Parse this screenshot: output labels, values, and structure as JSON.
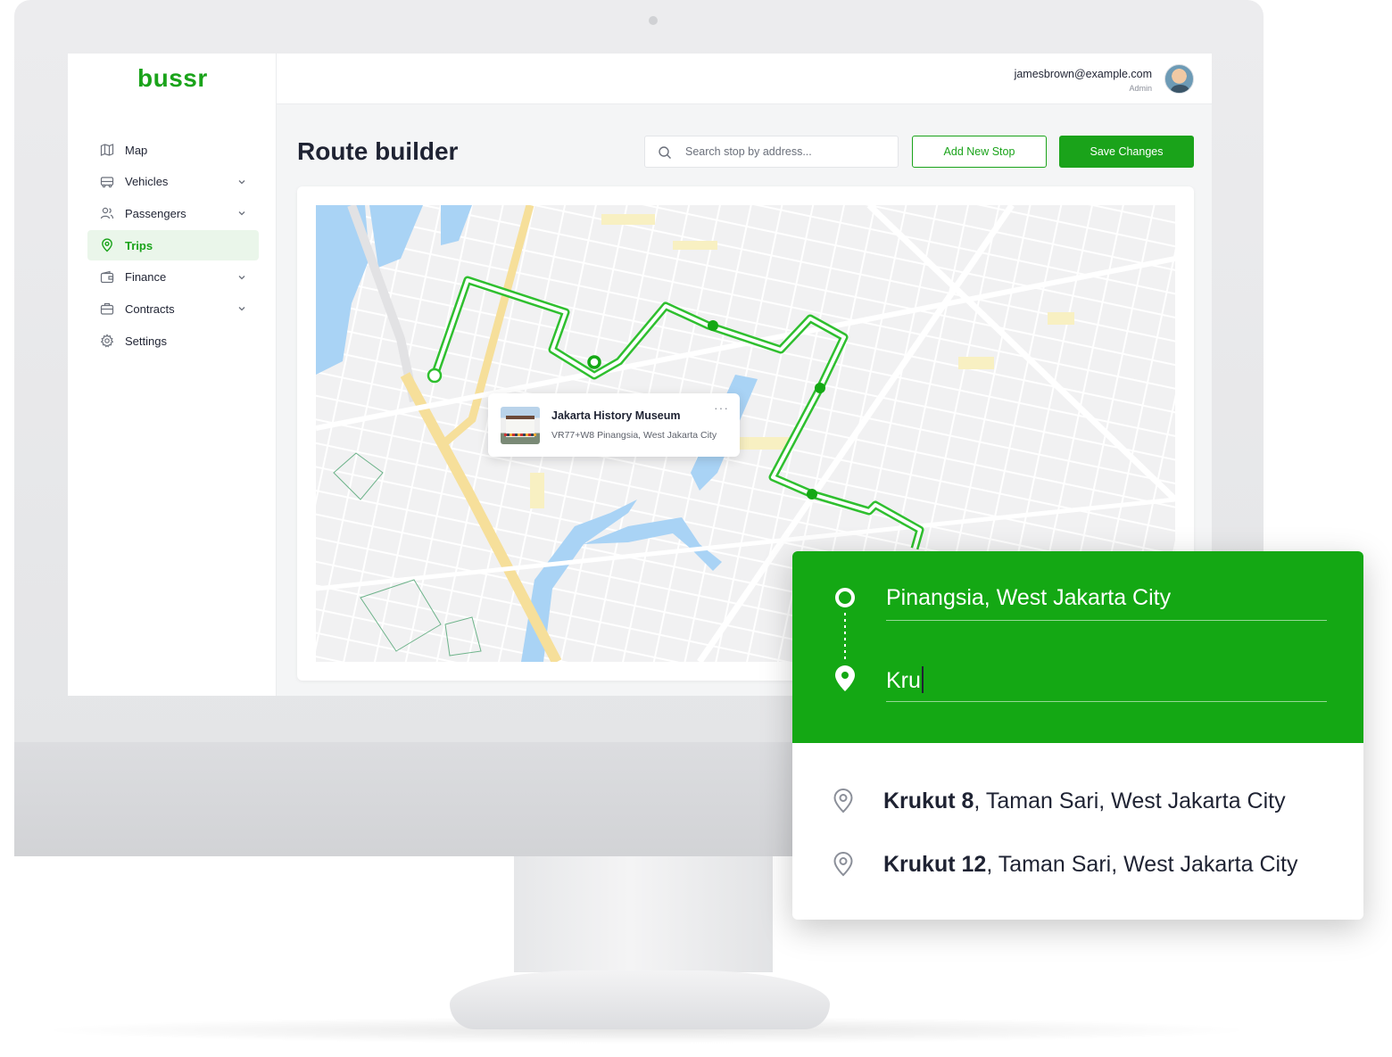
{
  "brand": {
    "logo_text": "bussr",
    "accent_color": "#1aa31a"
  },
  "sidebar": {
    "items": [
      {
        "label": "Map",
        "icon": "map-icon",
        "has_chevron": false,
        "active": false
      },
      {
        "label": "Vehicles",
        "icon": "bus-icon",
        "has_chevron": true,
        "active": false
      },
      {
        "label": "Passengers",
        "icon": "users-icon",
        "has_chevron": true,
        "active": false
      },
      {
        "label": "Trips",
        "icon": "location-pin-icon",
        "has_chevron": false,
        "active": true
      },
      {
        "label": "Finance",
        "icon": "wallet-icon",
        "has_chevron": true,
        "active": false
      },
      {
        "label": "Contracts",
        "icon": "briefcase-icon",
        "has_chevron": true,
        "active": false
      },
      {
        "label": "Settings",
        "icon": "gear-icon",
        "has_chevron": false,
        "active": false
      }
    ]
  },
  "header": {
    "user_email": "jamesbrown@example.com",
    "user_role": "Admin"
  },
  "page": {
    "title": "Route builder",
    "search_placeholder": "Search stop by address...",
    "add_stop_label": "Add New Stop",
    "save_label": "Save Changes"
  },
  "map": {
    "popup": {
      "title": "Jakarta History Museum",
      "address": "VR77+W8 Pinangsia, West Jakarta City",
      "more_label": "···"
    }
  },
  "route_panel": {
    "origin_value": "Pinangsia, West Jakarta City",
    "destination_value": "Kru",
    "suggestions": [
      {
        "bold": "Krukut 8",
        "rest": ", Taman Sari, West Jakarta City"
      },
      {
        "bold": "Krukut 12",
        "rest": ", Taman Sari, West Jakarta City"
      }
    ]
  }
}
